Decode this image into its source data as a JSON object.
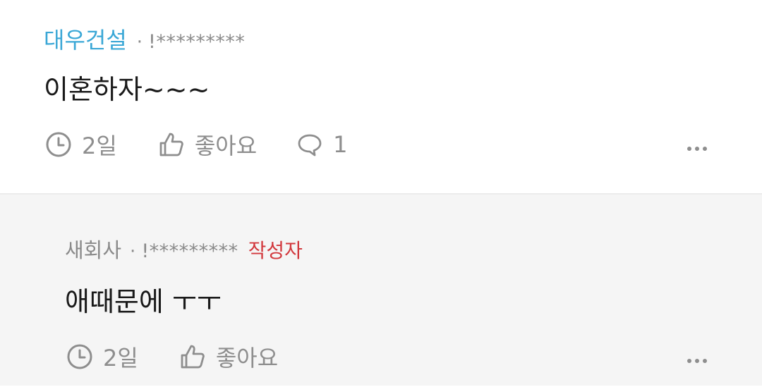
{
  "comments": [
    {
      "author": "대우건설",
      "separator": "·",
      "masked_id": "!*********",
      "body": "이혼하자~~~",
      "time": "2일",
      "like_label": "좋아요",
      "reply_count": "1"
    },
    {
      "author": "새회사",
      "separator": "·",
      "masked_id": "!*********",
      "badge": "작성자",
      "body": "애때문에 ㅜㅜ",
      "time": "2일",
      "like_label": "좋아요"
    }
  ],
  "colors": {
    "author_link": "#3aa7d6",
    "writer_badge": "#d2383d",
    "meta_gray": "#8e8e8e",
    "reply_bg": "#f5f5f5"
  },
  "icons": [
    "clock-icon",
    "thumbs-up-icon",
    "speech-bubble-icon",
    "more-dots-icon"
  ]
}
